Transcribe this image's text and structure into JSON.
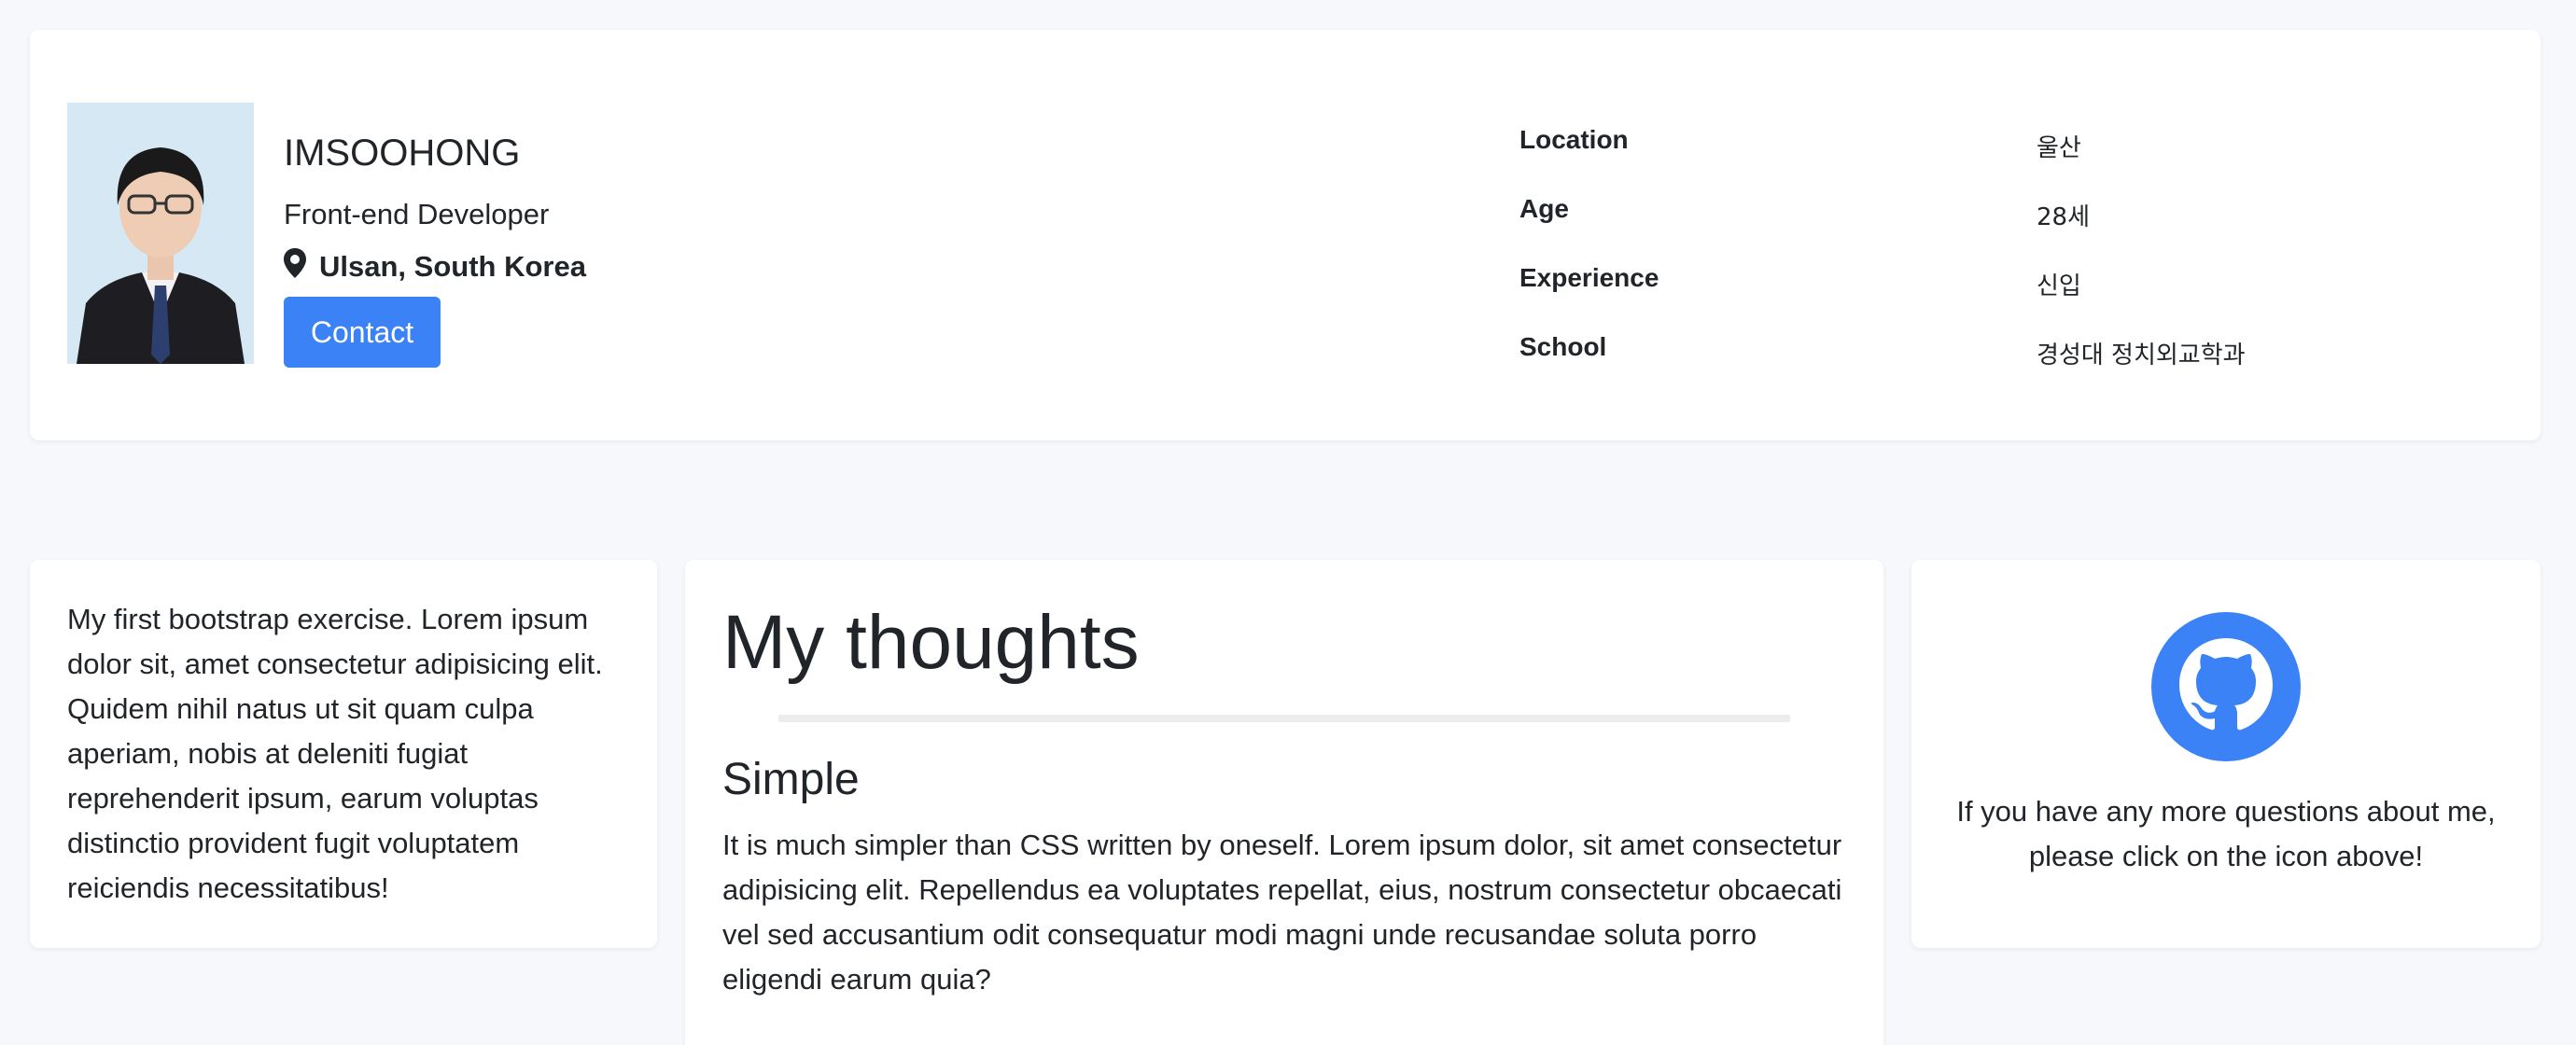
{
  "profile": {
    "name": "IMSOOHONG",
    "role": "Front-end Developer",
    "location": "Ulsan, South Korea",
    "contact_label": "Contact",
    "info": [
      {
        "label": "Location",
        "value": "울산"
      },
      {
        "label": "Age",
        "value": "28세"
      },
      {
        "label": "Experience",
        "value": "신입"
      },
      {
        "label": "School",
        "value": "경성대 정치외교학과"
      }
    ]
  },
  "intro": {
    "text": "My first bootstrap exercise. Lorem ipsum dolor sit, amet consectetur adipisicing elit. Quidem nihil natus ut sit quam culpa aperiam, nobis at deleniti fugiat reprehenderit ipsum, earum voluptas distinctio provident fugit voluptatem reiciendis necessitatibus!"
  },
  "thoughts": {
    "title": "My thoughts",
    "section_title": "Simple",
    "section_text": "It is much simpler than CSS written by oneself. Lorem ipsum dolor, sit amet consectetur adipisicing elit. Repellendus ea voluptates repellat, eius, nostrum consectetur obcaecati vel sed accusantium odit consequatur modi magni unde recusandae soluta porro eligendi earum quia?"
  },
  "github": {
    "icon": "github-icon",
    "text": "If you have any more questions about me, please click on the icon above!"
  },
  "colors": {
    "accent": "#3b82f6",
    "background": "#f7f8fb",
    "card": "#ffffff",
    "text": "#212529"
  }
}
